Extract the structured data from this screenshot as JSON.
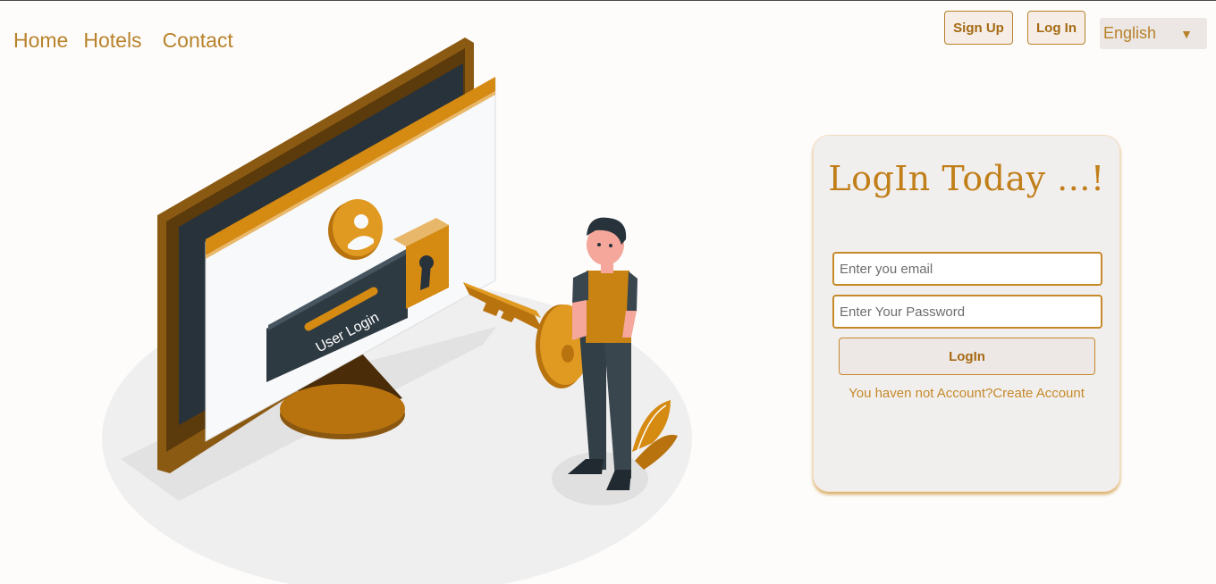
{
  "nav": {
    "home": "Home",
    "hotels": "Hotels",
    "contact": "Contact"
  },
  "header": {
    "signup": "Sign Up",
    "login": "Log In",
    "language": "English"
  },
  "illustration": {
    "label": "User Login"
  },
  "login_card": {
    "title": "LogIn Today ...!",
    "email_placeholder": "Enter you email",
    "password_placeholder": "Enter Your Password",
    "button": "LogIn",
    "footer_text": "You haven not Account?",
    "footer_link": "Create Account"
  },
  "colors": {
    "accent": "#c17f1a",
    "card": "#f1efee",
    "page": "#fdfcfb"
  },
  "icons": [
    "user-icon",
    "keyhole-icon",
    "key-icon",
    "chevron-down-icon"
  ]
}
